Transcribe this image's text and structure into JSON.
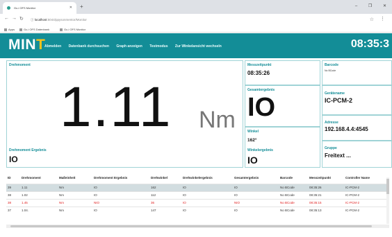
{
  "browser": {
    "tab_title": "Gc-i OFS Monitor",
    "url_host": "localhost",
    "url_path": ":5044/ppysonmentor/Monitor",
    "bookmarks": [
      "Apps",
      "Gc-i OFS Datenbank",
      "Gc-i OFS Monitor"
    ]
  },
  "app": {
    "logo": "MIN",
    "logo_accent": "T",
    "nav": [
      "Abmelden",
      "Datenbank durchsuchen",
      "Graph anzeigen",
      "Testmodus",
      "Zur Winkelansicht wechseln"
    ],
    "clock": "08:35:3"
  },
  "torque": {
    "label": "Drehmoment",
    "value": "1.11",
    "unit": "Nm",
    "result_label": "Drehmoment Ergebnis",
    "result_value": "IO"
  },
  "measure_time": {
    "label": "Messzeitpunkt",
    "value": "08:35:26"
  },
  "total_result": {
    "label": "Gesamtergebnis",
    "value": "IO"
  },
  "angle": {
    "label": "Winkel",
    "value": "162°",
    "result_label": "Winkelergebnis",
    "result_value": "IO"
  },
  "barcode": {
    "label": "Barcode",
    "value": "No BCode"
  },
  "device": {
    "label": "Gerätename",
    "value": "IC-PCM-2"
  },
  "address": {
    "label": "Adresse",
    "value": "192.168.4.4:4545"
  },
  "group": {
    "label": "Gruppe",
    "value": "Freitext ..."
  },
  "table": {
    "headers": [
      "ID",
      "Drehmoment",
      "Maßeinheit",
      "Drehmoment Ergebnis",
      "Drehwinkel",
      "Drehwinkelergebnis",
      "Gesamtergebnis",
      "Barcode",
      "Messzeitpunkt",
      "Controller Name"
    ],
    "rows": [
      [
        "39",
        "1.11",
        "Nm",
        "IO",
        "162",
        "IO",
        "IO",
        "No BCode",
        "08:35:26",
        "IC-PCM-2"
      ],
      [
        "38",
        "1.02",
        "Nm",
        "IO",
        "112",
        "IO",
        "IO",
        "No BCode",
        "08:35:21",
        "IC-PCM-2"
      ],
      [
        "38",
        "1.45",
        "Nm",
        "NIO",
        "36",
        "IO",
        "NIO",
        "No BCode",
        "08:35:15",
        "IC-PCM-2"
      ],
      [
        "37",
        "1.04.",
        "Nm",
        "IO",
        "147",
        "IO",
        "IO",
        "No BCode",
        "08:35:13",
        "IC-PCM-2"
      ]
    ]
  },
  "colors": {
    "accent": "#138d97",
    "logo_dot": "#f5c21b",
    "error": "#e02020",
    "selected_row": "#d2dde0"
  }
}
